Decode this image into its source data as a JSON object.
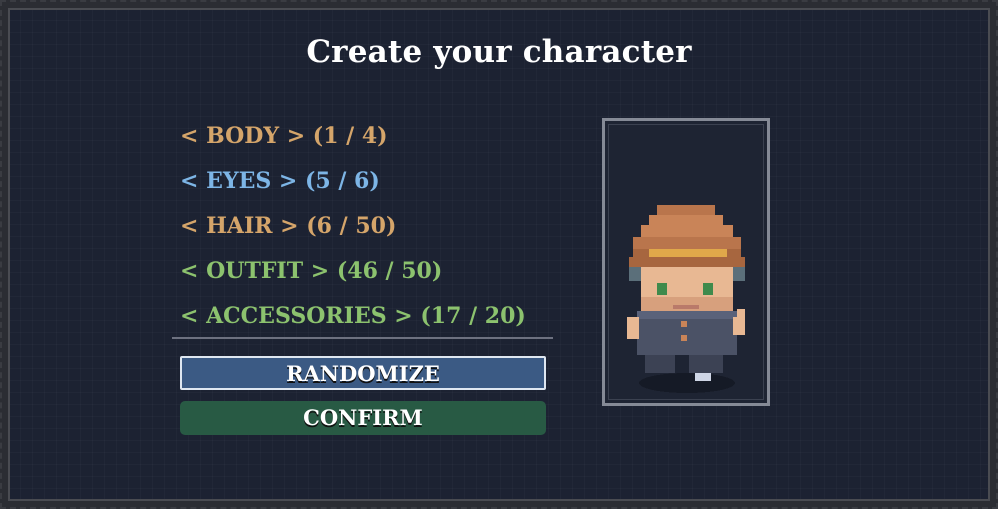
{
  "title": "Create your character",
  "options": [
    {
      "text": "< BODY > (1 / 4)",
      "color": "#d5a56a"
    },
    {
      "text": "< EYES > (5 / 6)",
      "color": "#7db5e6"
    },
    {
      "text": "< HAIR > (6 / 50)",
      "color": "#d5a56a"
    },
    {
      "text": "< OUTFIT > (46 / 50)",
      "color": "#8cc26e"
    },
    {
      "text": "< ACCESSORIES > (17 / 20)",
      "color": "#8cc26e"
    }
  ],
  "buttons": {
    "randomize": "RANDOMIZE",
    "confirm": "CONFIRM"
  },
  "colors": {
    "background": "#1c2232",
    "randomize_bg": "#3b5a84",
    "confirm_bg": "#285a44"
  }
}
